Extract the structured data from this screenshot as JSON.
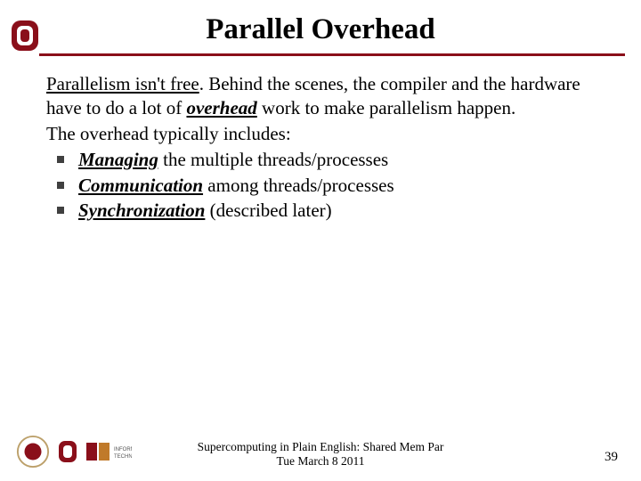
{
  "title": "Parallel Overhead",
  "body": {
    "para1_lead": "Parallelism isn't free",
    "para1_rest1": ". Behind the scenes, the compiler and the hardware have to do a lot of ",
    "para1_overhead": "overhead",
    "para1_rest2": " work to make parallelism happen.",
    "para2": "The overhead typically includes:",
    "bullets": [
      {
        "term": "Managing",
        "rest": " the multiple threads/processes"
      },
      {
        "term": "Communication",
        "rest": " among threads/processes"
      },
      {
        "term": "Synchronization",
        "rest": " (described later)"
      }
    ]
  },
  "footer": {
    "line1": "Supercomputing in Plain English: Shared Mem Par",
    "line2": "Tue March 8 2011"
  },
  "slide_number": "39",
  "colors": {
    "crimson": "#8a0f1a"
  }
}
